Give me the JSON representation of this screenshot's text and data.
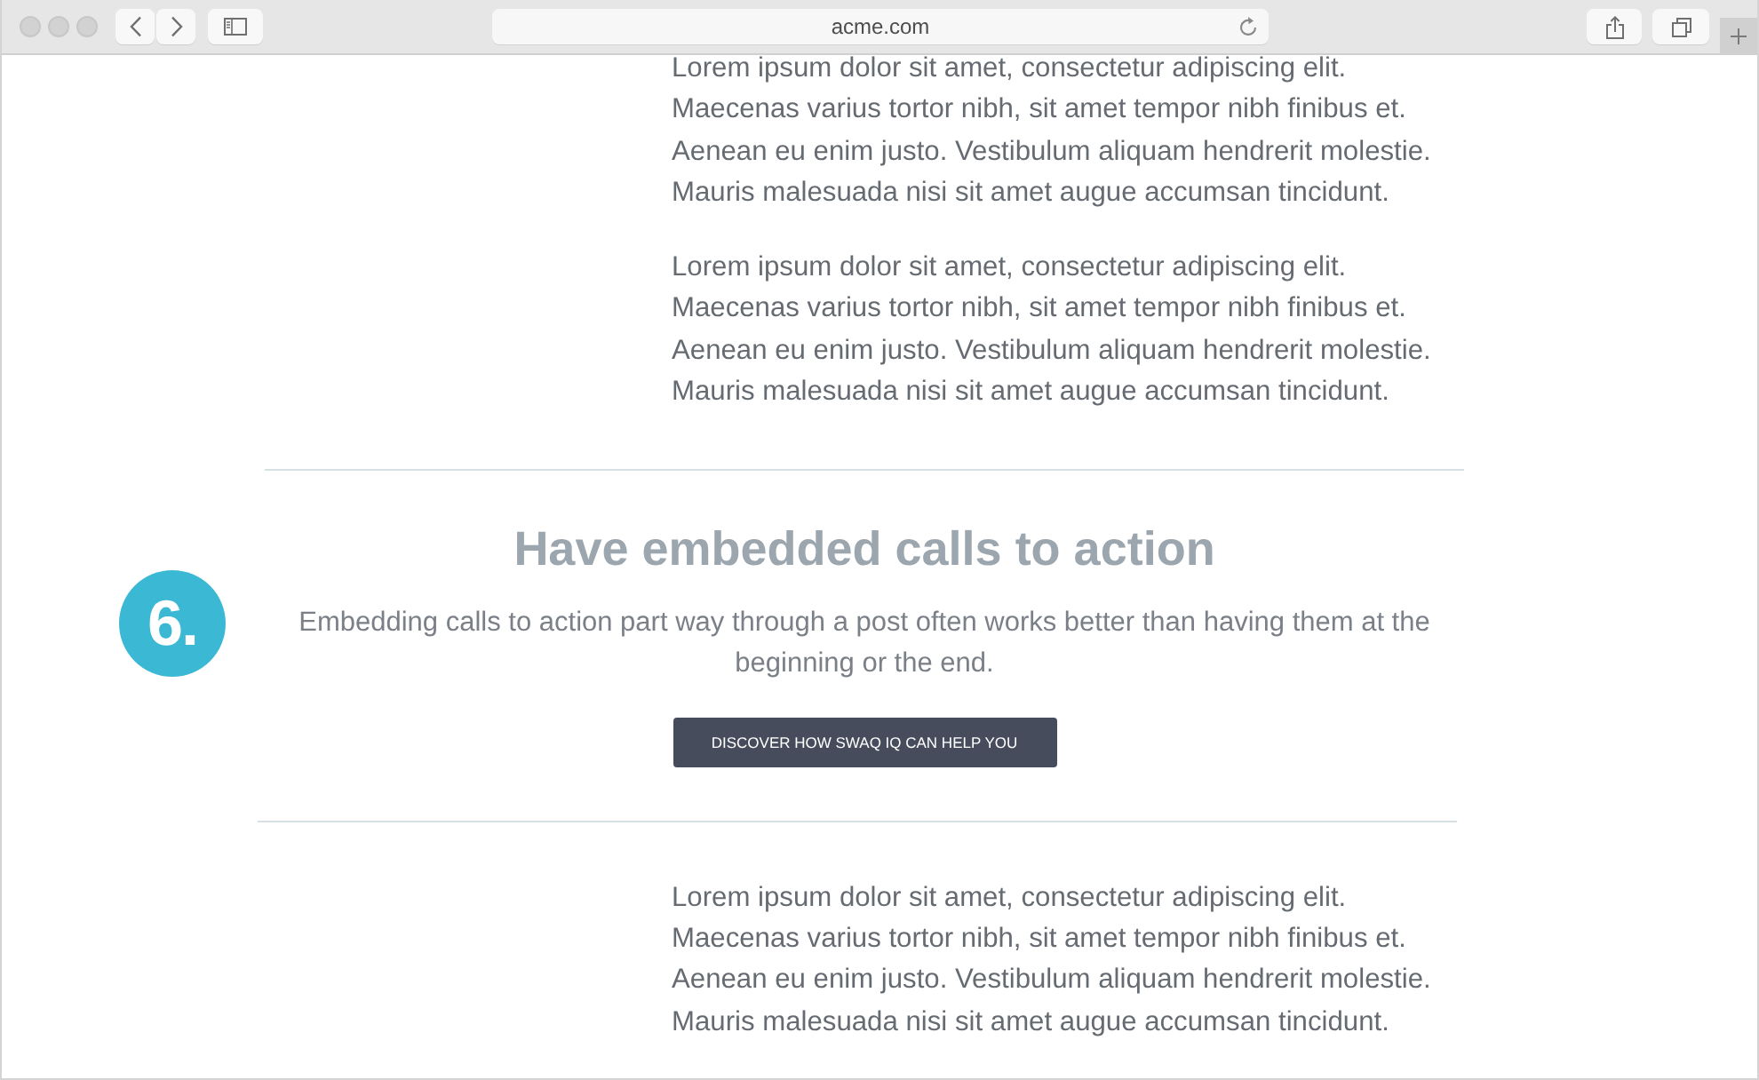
{
  "window": {
    "url": "acme.com"
  },
  "article": {
    "paragraphs_before": [
      {
        "lines": [
          "Lorem ipsum dolor sit amet, consectetur adipiscing elit.",
          "Maecenas varius tortor nibh, sit amet tempor nibh finibus et.",
          "Aenean eu enim justo. Vestibulum aliquam hendrerit molestie.",
          "Mauris malesuada nisi sit amet augue accumsan tincidunt."
        ]
      },
      {
        "lines": [
          "Lorem ipsum dolor sit amet, consectetur adipiscing elit.",
          "Maecenas varius tortor nibh, sit amet tempor nibh finibus et.",
          "Aenean eu enim justo. Vestibulum aliquam hendrerit molestie.",
          "Mauris malesuada nisi sit amet augue accumsan tincidunt."
        ]
      }
    ],
    "call_to_action": {
      "number": "6.",
      "heading": "Have embedded calls to action",
      "description_lines": [
        "Embedding calls to action part way through a post often works better than having them at the",
        "beginning or the end."
      ],
      "button": "DISCOVER HOW SWAQ IQ CAN HELP YOU"
    },
    "paragraphs_after": [
      {
        "lines": [
          "Lorem ipsum dolor sit amet, consectetur adipiscing elit.",
          "Maecenas varius tortor nibh, sit amet tempor nibh finibus et.",
          "Aenean eu enim justo. Vestibulum aliquam hendrerit molestie.",
          "Mauris malesuada nisi sit amet augue accumsan tincidunt."
        ]
      }
    ]
  }
}
